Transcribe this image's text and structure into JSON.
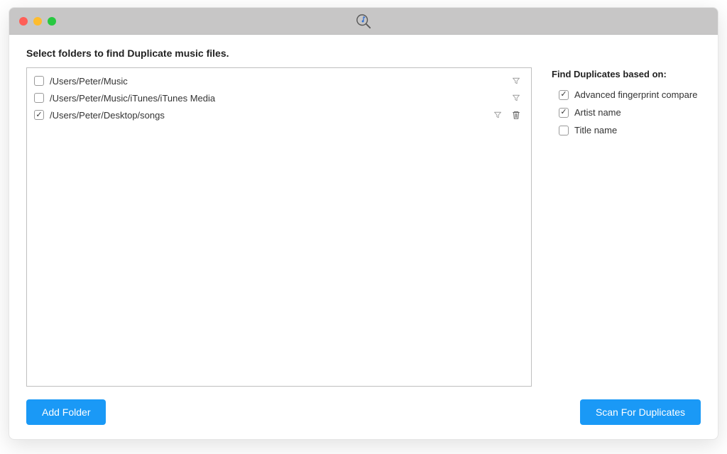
{
  "heading": "Select folders to find Duplicate music files.",
  "folders": [
    {
      "path": "/Users/Peter/Music",
      "checked": false,
      "removable": false
    },
    {
      "path": "/Users/Peter/Music/iTunes/iTunes Media",
      "checked": false,
      "removable": false
    },
    {
      "path": "/Users/Peter/Desktop/songs",
      "checked": true,
      "removable": true
    }
  ],
  "side": {
    "heading": "Find Duplicates based on:",
    "options": [
      {
        "label": "Advanced fingerprint compare",
        "checked": true
      },
      {
        "label": "Artist name",
        "checked": true
      },
      {
        "label": "Title name",
        "checked": false
      }
    ]
  },
  "buttons": {
    "add_folder": "Add Folder",
    "scan": "Scan For Duplicates"
  },
  "colors": {
    "primary": "#1a99f6"
  }
}
